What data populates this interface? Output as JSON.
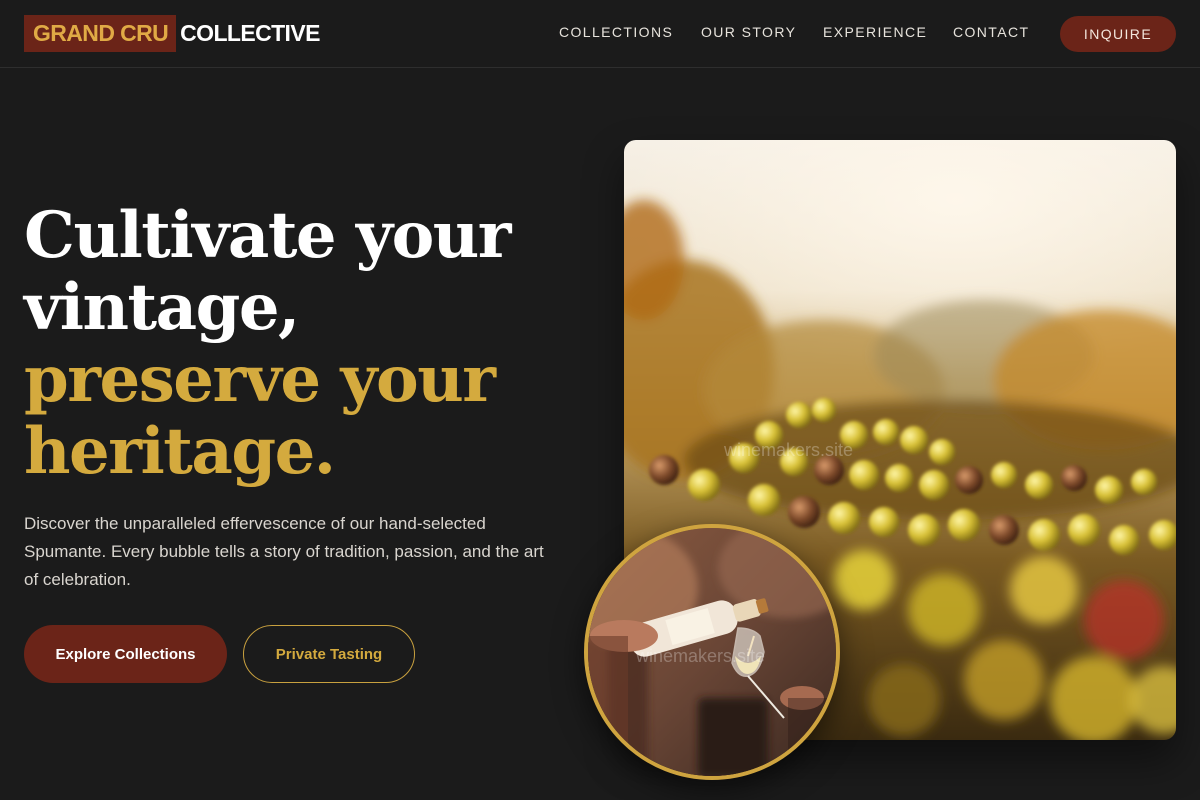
{
  "brand": {
    "mark": "GRAND CRU",
    "name": "COLLECTIVE"
  },
  "nav": {
    "items": [
      {
        "label": "COLLECTIONS"
      },
      {
        "label": "OUR STORY"
      },
      {
        "label": "EXPERIENCE"
      },
      {
        "label": "CONTACT"
      }
    ],
    "cta_label": "INQUIRE"
  },
  "hero": {
    "headline_line1": "Cultivate your",
    "headline_line2": "vintage,",
    "headline_line3": "preserve your",
    "headline_line4": "heritage.",
    "description": "Discover the unparalleled effervescence of our hand-selected Spumante. Every bubble tells a story of tradition, passion, and the art of celebration.",
    "primary_cta": "Explore Collections",
    "secondary_cta": "Private Tasting"
  },
  "images": {
    "main_watermark": "winemakers.site",
    "inset_watermark": "winemakers.site",
    "main_icon": "vineyard-grapes-photo",
    "inset_icon": "wine-pouring-photo"
  },
  "colors": {
    "background": "#1b1b1b",
    "burgundy": "#6b2418",
    "gold": "#d4aa3e"
  }
}
